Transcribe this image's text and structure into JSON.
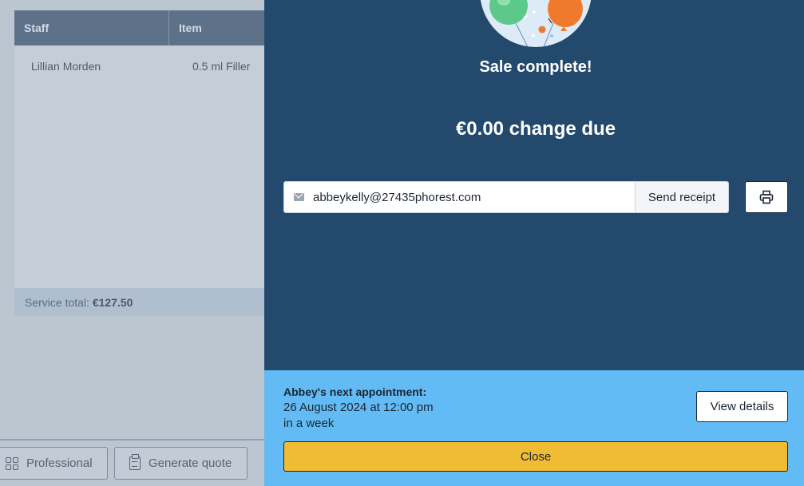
{
  "background": {
    "table": {
      "headers": [
        "Staff",
        "Item"
      ],
      "rows": [
        {
          "staff": "Lillian Morden",
          "item": "0.5 ml Filler"
        }
      ],
      "footer_label": "Service total:",
      "footer_value": "€127.50"
    },
    "bottombar": {
      "professional_label": "Professional",
      "quote_label": "Generate quote"
    }
  },
  "modal": {
    "title": "Sale complete!",
    "change_due": "€0.00 change due",
    "email": {
      "value": "abbeykelly@27435phorest.com"
    },
    "send_receipt_label": "Send receipt",
    "next_appointment": {
      "title": "Abbey's next appointment:",
      "date": "26 August 2024 at 12:00 pm",
      "relative": "in a week",
      "view_details_label": "View details"
    },
    "close_label": "Close"
  },
  "colors": {
    "panel": "#23496d",
    "appointment_banner": "#63bbf5",
    "close_button": "#f0bc34"
  }
}
